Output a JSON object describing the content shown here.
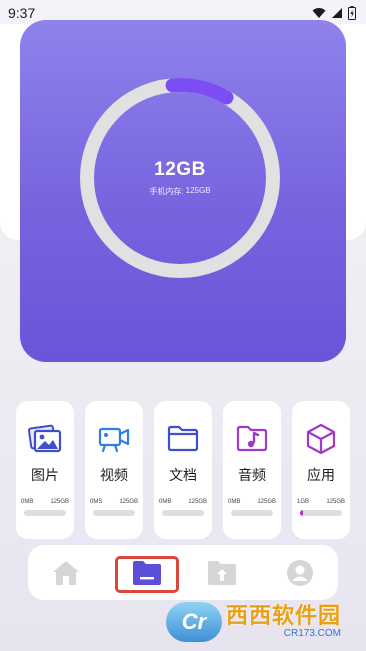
{
  "status_bar": {
    "time": "9:37",
    "icons": [
      "wifi-icon",
      "signal-icon",
      "battery-icon"
    ]
  },
  "storage": {
    "used": "12GB",
    "total_label": "手机内存:",
    "total_value": "125GB",
    "used_fraction": 0.096,
    "colors": {
      "ring_track": "#e1e1e1",
      "ring_fill": "#7b4ef3"
    }
  },
  "categories": [
    {
      "id": "images",
      "label": "图片",
      "used": "0MB",
      "total": "125GB",
      "fraction": 0,
      "icon": "image-gallery-icon",
      "color": "#3f4fc9"
    },
    {
      "id": "videos",
      "label": "视频",
      "used": "0MS",
      "total": "125GB",
      "fraction": 0,
      "icon": "video-camera-icon",
      "color": "#2b7fe6"
    },
    {
      "id": "documents",
      "label": "文档",
      "used": "0MB",
      "total": "125GB",
      "fraction": 0,
      "icon": "folder-icon",
      "color": "#3f4fc9"
    },
    {
      "id": "audio",
      "label": "音频",
      "used": "0MB",
      "total": "125GB",
      "fraction": 0,
      "icon": "music-folder-icon",
      "color": "#9f39c9"
    },
    {
      "id": "apps",
      "label": "应用",
      "used": "1GB",
      "total": "125GB",
      "fraction": 0.03,
      "icon": "cube-icon",
      "color": "#9f39c9"
    }
  ],
  "bottom_nav": {
    "items": [
      {
        "id": "home",
        "icon": "home-icon",
        "active": false
      },
      {
        "id": "files",
        "icon": "file-folder-icon",
        "active": true
      },
      {
        "id": "upload",
        "icon": "upload-folder-icon",
        "active": false
      },
      {
        "id": "profile",
        "icon": "user-icon",
        "active": false
      }
    ],
    "colors": {
      "active": "#5a4fd6",
      "inactive": "#d6d6d6"
    }
  },
  "watermark": {
    "badge_text": "Cr",
    "main": "西西软件园",
    "sub": "CR173.COM"
  }
}
